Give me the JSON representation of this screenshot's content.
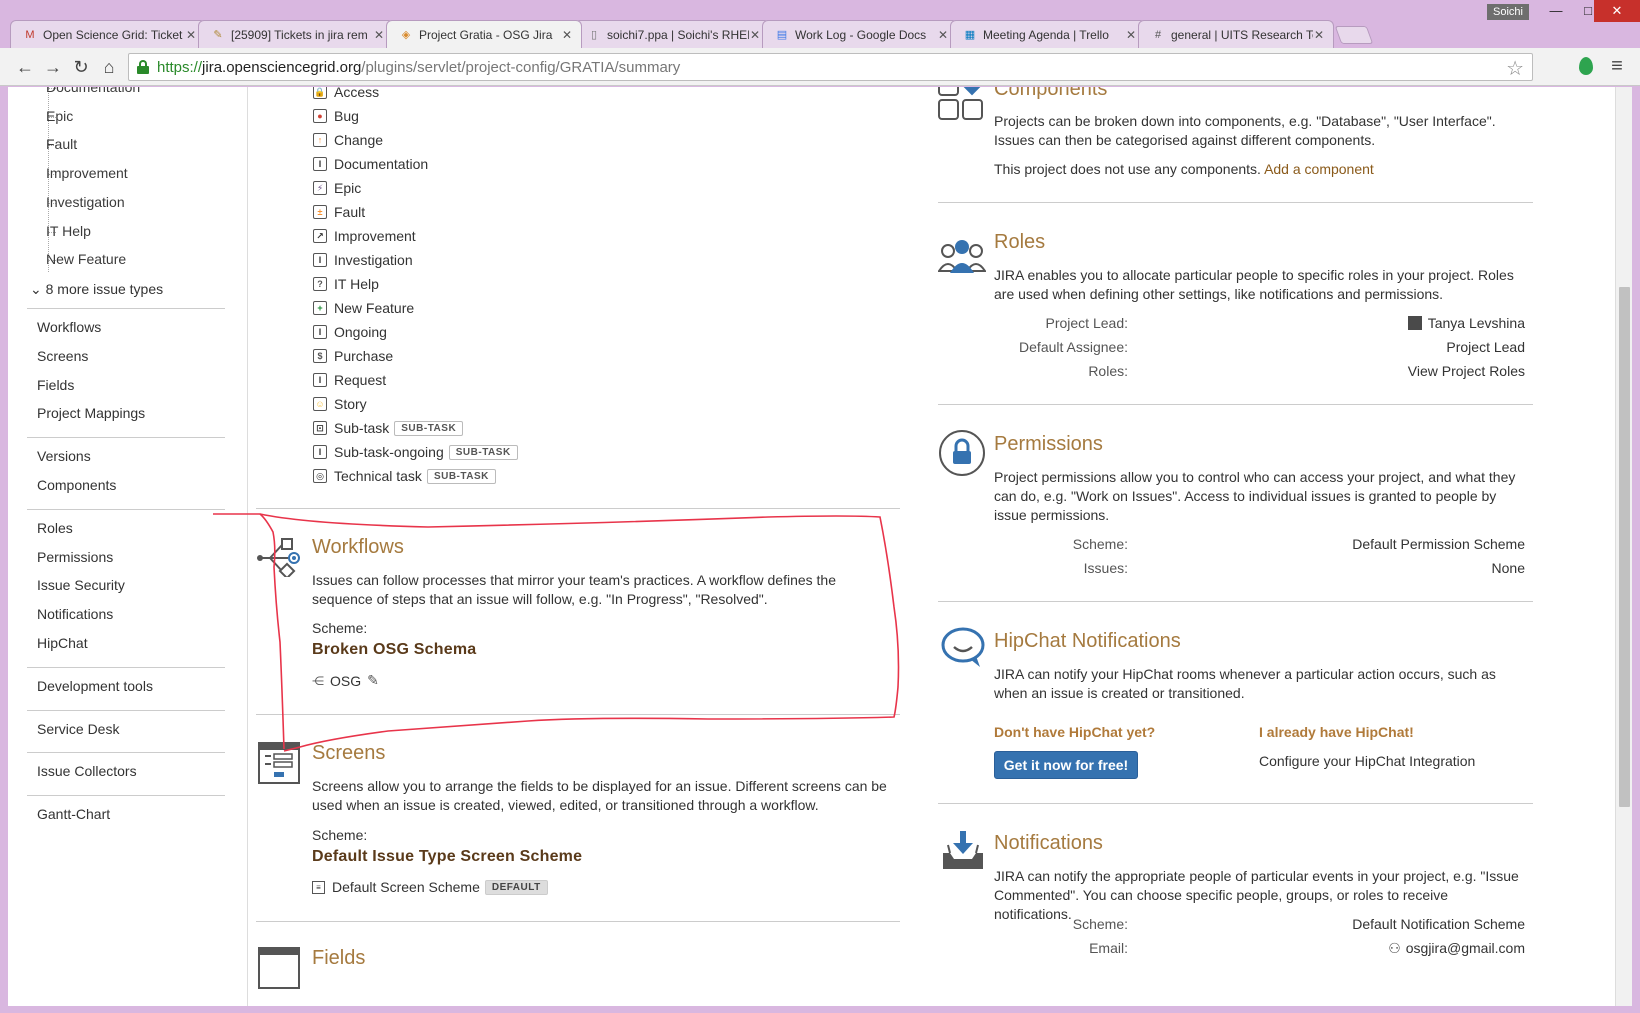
{
  "browser": {
    "user": "Soichi",
    "tabs": [
      {
        "label": "Open Science Grid: Ticket",
        "icon": "gmail-icon",
        "active": false
      },
      {
        "label": "[25909] Tickets in jira rem",
        "icon": "tag-icon",
        "active": false
      },
      {
        "label": "Project Gratia - OSG Jira",
        "icon": "jira-icon",
        "active": true
      },
      {
        "label": "soichi7.ppa | Soichi's RHEI",
        "icon": "page-icon",
        "active": false
      },
      {
        "label": "Work Log - Google Docs",
        "icon": "docs-icon",
        "active": false
      },
      {
        "label": "Meeting Agenda | Trello",
        "icon": "trello-icon",
        "active": false
      },
      {
        "label": "general | UITS Research Te",
        "icon": "slack-icon",
        "active": false
      }
    ],
    "url": {
      "scheme": "https://",
      "host": "jira.opensciencegrid.org",
      "path": "/plugins/servlet/project-config/GRATIA/summary"
    }
  },
  "sidebar": {
    "issue_types": [
      "Documentation",
      "Epic",
      "Fault",
      "Improvement",
      "Investigation",
      "IT Help",
      "New Feature"
    ],
    "more_link": "8 more issue types",
    "groups": [
      [
        "Workflows",
        "Screens",
        "Fields",
        "Project Mappings"
      ],
      [
        "Versions",
        "Components"
      ],
      [
        "Roles",
        "Permissions",
        "Issue Security",
        "Notifications",
        "HipChat"
      ],
      [
        "Development tools"
      ],
      [
        "Service Desk"
      ],
      [
        "Issue Collectors"
      ],
      [
        "Gantt-Chart"
      ]
    ]
  },
  "issue_types": [
    {
      "label": "Access",
      "glyph": "🔒",
      "badge": ""
    },
    {
      "label": "Bug",
      "glyph": "●",
      "badge": ""
    },
    {
      "label": "Change",
      "glyph": "↑",
      "badge": ""
    },
    {
      "label": "Documentation",
      "glyph": "I",
      "badge": ""
    },
    {
      "label": "Epic",
      "glyph": "⚡",
      "badge": ""
    },
    {
      "label": "Fault",
      "glyph": "±",
      "badge": ""
    },
    {
      "label": "Improvement",
      "glyph": "↗",
      "badge": ""
    },
    {
      "label": "Investigation",
      "glyph": "I",
      "badge": ""
    },
    {
      "label": "IT Help",
      "glyph": "?",
      "badge": ""
    },
    {
      "label": "New Feature",
      "glyph": "+",
      "badge": ""
    },
    {
      "label": "Ongoing",
      "glyph": "I",
      "badge": ""
    },
    {
      "label": "Purchase",
      "glyph": "$",
      "badge": ""
    },
    {
      "label": "Request",
      "glyph": "I",
      "badge": ""
    },
    {
      "label": "Story",
      "glyph": "☺",
      "badge": ""
    },
    {
      "label": "Sub-task",
      "glyph": "⊡",
      "badge": "SUB-TASK"
    },
    {
      "label": "Sub-task-ongoing",
      "glyph": "I",
      "badge": "SUB-TASK"
    },
    {
      "label": "Technical task",
      "glyph": "◎",
      "badge": "SUB-TASK"
    }
  ],
  "workflows": {
    "title": "Workflows",
    "text": "Issues can follow processes that mirror your team's practices. A workflow defines the sequence of steps that an issue will follow, e.g. \"In Progress\", \"Resolved\".",
    "scheme_label": "Scheme:",
    "scheme": "Broken OSG Schema",
    "link": "OSG"
  },
  "screens": {
    "title": "Screens",
    "text": "Screens allow you to arrange the fields to be displayed for an issue. Different screens can be used when an issue is created, viewed, edited, or transitioned through a workflow.",
    "scheme_label": "Scheme:",
    "scheme": "Default Issue Type Screen Scheme",
    "link": "Default Screen Scheme",
    "badge": "DEFAULT"
  },
  "fields": {
    "title": "Fields"
  },
  "components": {
    "title": "Components",
    "text": "Projects can be broken down into components, e.g. \"Database\", \"User Interface\". Issues can then be categorised against different components.",
    "none_text": "This project does not use any components.",
    "add_link": "Add a component"
  },
  "roles": {
    "title": "Roles",
    "text": "JIRA enables you to allocate particular people to specific roles in your project. Roles are used when defining other settings, like notifications and permissions.",
    "rows": [
      {
        "label": "Project Lead:",
        "value": "Tanya Levshina"
      },
      {
        "label": "Default Assignee:",
        "value": "Project Lead"
      },
      {
        "label": "Roles:",
        "value": "View Project Roles"
      }
    ]
  },
  "permissions": {
    "title": "Permissions",
    "text": "Project permissions allow you to control who can access your project, and what they can do, e.g. \"Work on Issues\". Access to individual issues is granted to people by issue permissions.",
    "rows": [
      {
        "label": "Scheme:",
        "value": "Default Permission Scheme"
      },
      {
        "label": "Issues:",
        "value": "None"
      }
    ]
  },
  "hipchat": {
    "title": "HipChat Notifications",
    "text": "JIRA can notify your HipChat rooms whenever a particular action occurs, such as when an issue is created or transitioned.",
    "no_head": "Don't have HipChat yet?",
    "cta": "Get it now for free!",
    "have_head": "I already have HipChat!",
    "configure": "Configure your HipChat Integration"
  },
  "notifications": {
    "title": "Notifications",
    "text": "JIRA can notify the appropriate people of particular events in your project, e.g. \"Issue Commented\". You can choose specific people, groups, or roles to receive notifications.",
    "rows": [
      {
        "label": "Scheme:",
        "value": "Default Notification Scheme"
      },
      {
        "label": "Email:",
        "value": "osgjira@gmail.com"
      }
    ]
  },
  "colors": {
    "section_title": "#a57a3f",
    "accent_blue": "#3572b0",
    "annotation_red": "#e8344a"
  }
}
